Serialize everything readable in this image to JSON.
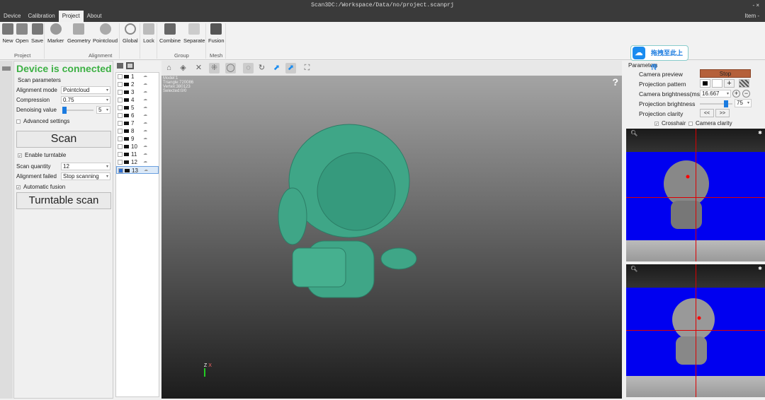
{
  "window": {
    "title": "Scan3DC:/Workspace/Data/no/project.scanprj",
    "controls": "-  ×",
    "item_menu": "Item -"
  },
  "tabs": [
    "Device",
    "Calibration",
    "Project",
    "About"
  ],
  "ribbon": {
    "buttons": [
      "New",
      "Open",
      "Save",
      "Marker",
      "Geometry",
      "Pointcloud",
      "Global",
      "Lock",
      "Combine",
      "Separate",
      "Fusion"
    ],
    "groups": [
      "Project",
      "Alignment",
      "Group",
      "Mesh"
    ]
  },
  "left": {
    "status": "Device is connected",
    "status_color": "#3cb043",
    "section": "Scan parameters",
    "alignment_mode_label": "Alignment mode",
    "alignment_mode": "Pointcloud",
    "compression_label": "Compression",
    "compression": "0.75",
    "denoise_label": "Denoising value",
    "denoise": "5",
    "denoise_fraction": 0.1,
    "advanced": "Advanced settings",
    "scan": "Scan",
    "turntable": "Enable turntable",
    "scan_qty_label": "Scan quantity",
    "scan_qty": "12",
    "align_failed_label": "Alignment failed",
    "align_failed": "Stop scanning",
    "auto_fusion": "Automatic fusion",
    "turntable_scan": "Turntable scan"
  },
  "list": [
    "1",
    "2",
    "3",
    "4",
    "5",
    "6",
    "7",
    "8",
    "9",
    "10",
    "11",
    "12",
    "13"
  ],
  "viewport": {
    "info": [
      "Model:1",
      "Triangle:720086",
      "Vertex:380123",
      "Selected:0/0"
    ],
    "help": "?",
    "axis_z": "Z",
    "axis_x": "X"
  },
  "right": {
    "group": "Parameters",
    "camera_preview": "Camera preview",
    "stop": "Stop",
    "stop_color": "#b5603a",
    "pattern": "Projection pattern",
    "brightness_label": "Camera brightness(ms)",
    "brightness": "16.667",
    "proj_brightness_label": "Projection brightness",
    "proj_brightness": "75",
    "proj_fraction": 0.75,
    "clarity_label": "Projection clarity",
    "prev": "<<",
    "next": ">>",
    "crosshair": "Crosshair",
    "camera_clarity": "Camera clarity"
  },
  "upload": "拖拽至此上传"
}
